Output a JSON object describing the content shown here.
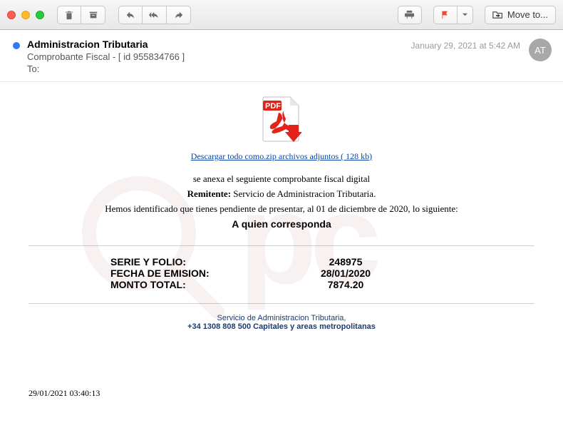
{
  "toolbar": {
    "move_label": "Move to..."
  },
  "header": {
    "from": "Administracion Tributaria",
    "subject": "Comprobante Fiscal - [ id 955834766  ]",
    "to_label": "To:",
    "to_value": "",
    "date": "January 29, 2021 at 5:42 AM",
    "avatar_initials": "AT"
  },
  "body": {
    "download_link": "Descargar todo como.zip archivos adjuntos ( 128 kb) ",
    "line1": "se anexa el seguiente comprobante fiscal digital",
    "remitente_label": "Remitente:",
    "remitente_value": " Servicio de Administracion Tributaria.",
    "line3": "Hemos identificado que tienes pendiente de presentar, al 01 de diciembre de 2020, lo siguiente:",
    "addressee": "A quien corresponda",
    "details": {
      "serie_folio_label": "SERIE Y FOLIO:",
      "serie_folio_value": "248975",
      "fecha_label": "FECHA DE EMISION:",
      "fecha_value": "28/01/2020",
      "monto_label": "MONTO TOTAL:",
      "monto_value": "7874.20"
    },
    "footer_line1": "Servicio de Administracion Tributaria,",
    "footer_line2": "+34 1308 808 500 Capitales y areas metropolitanas",
    "timestamp": "29/01/2021 03:40:13"
  }
}
